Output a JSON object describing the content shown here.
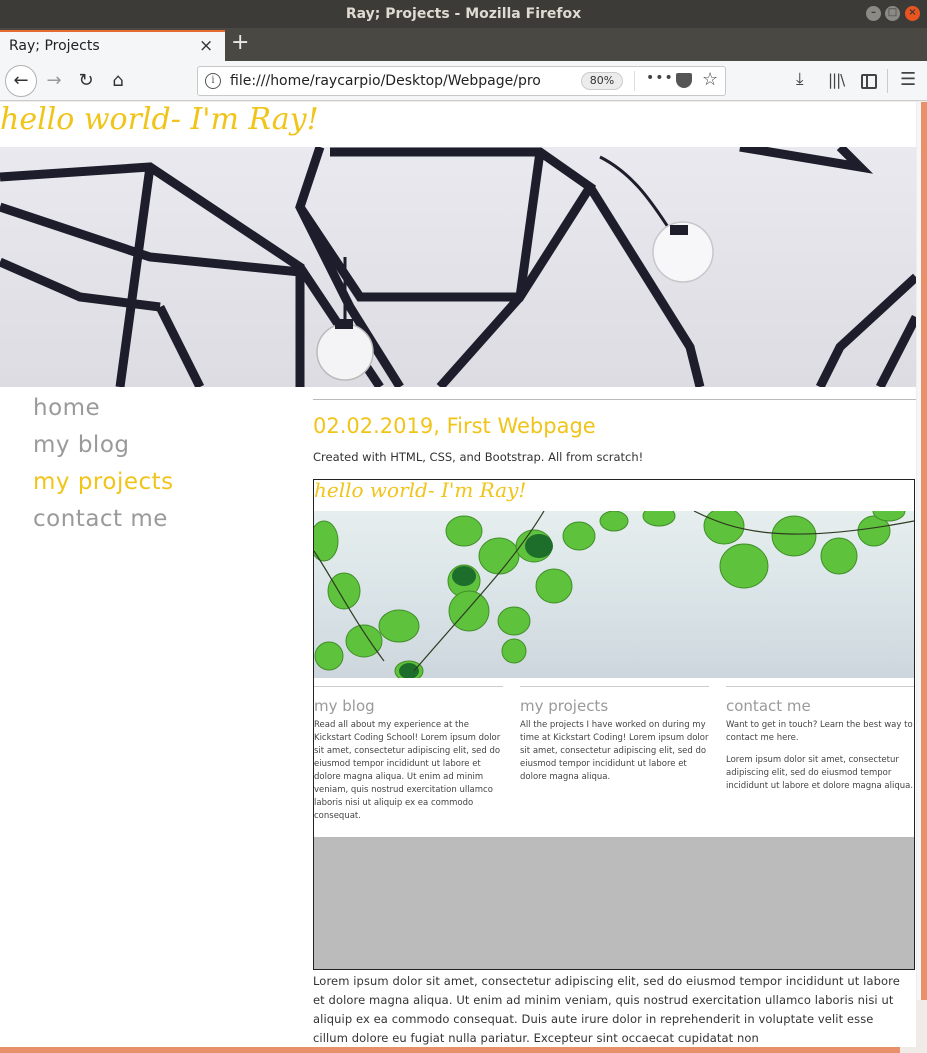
{
  "window": {
    "title": "Ray; Projects - Mozilla Firefox"
  },
  "tab": {
    "label": "Ray; Projects",
    "close": "×"
  },
  "newtab": "+",
  "nav": {
    "back": "←",
    "forward": "→",
    "reload": "↻",
    "home": "⌂",
    "url": "file:///home/raycarpio/Desktop/Webpage/pro",
    "zoom": "80%",
    "more": "•••",
    "star": "☆",
    "download": "⤓",
    "library": "|||\\",
    "menu": "☰",
    "info": "i"
  },
  "page": {
    "hello": "hello world- I'm Ray!",
    "nav_items": [
      "home",
      "my blog",
      "my projects",
      "contact me"
    ],
    "active_nav": "my projects",
    "post_title": "02.02.2019, First Webpage",
    "post_sub": "Created with HTML, CSS, and Bootstrap. All from scratch!",
    "preview": {
      "hello": "hello world- I'm Ray!",
      "columns": [
        {
          "title": "my blog",
          "text": [
            "Read all about my experience at the Kickstart Coding School! Lorem ipsum dolor sit amet, consectetur adipiscing elit, sed do eiusmod tempor incididunt ut labore et dolore magna aliqua. Ut enim ad minim veniam, quis nostrud exercitation ullamco laboris nisi ut aliquip ex ea commodo consequat."
          ]
        },
        {
          "title": "my projects",
          "text": [
            "All the projects I have worked on during my time at Kickstart Coding! Lorem ipsum dolor sit amet, consectetur adipiscing elit, sed do eiusmod tempor incididunt ut labore et dolore magna aliqua."
          ]
        },
        {
          "title": "contact me",
          "text": [
            "Want to get in touch? Learn the best way to contact me here.",
            "Lorem ipsum dolor sit amet, consectetur adipiscing elit, sed do eiusmod tempor incididunt ut labore et dolore magna aliqua."
          ]
        }
      ]
    },
    "body_text": "Lorem ipsum dolor sit amet, consectetur adipiscing elit, sed do eiusmod tempor incididunt ut labore et dolore magna aliqua. Ut enim ad minim veniam, quis nostrud exercitation ullamco laboris nisi ut aliquip ex ea commodo consequat. Duis aute irure dolor in reprehenderit in voluptate velit esse cillum dolore eu fugiat nulla pariatur. Excepteur sint occaecat cupidatat non"
  },
  "colors": {
    "accent": "#f0c419",
    "firefox_orange": "#e66b2f",
    "grey_nav": "#9a9a9a"
  }
}
